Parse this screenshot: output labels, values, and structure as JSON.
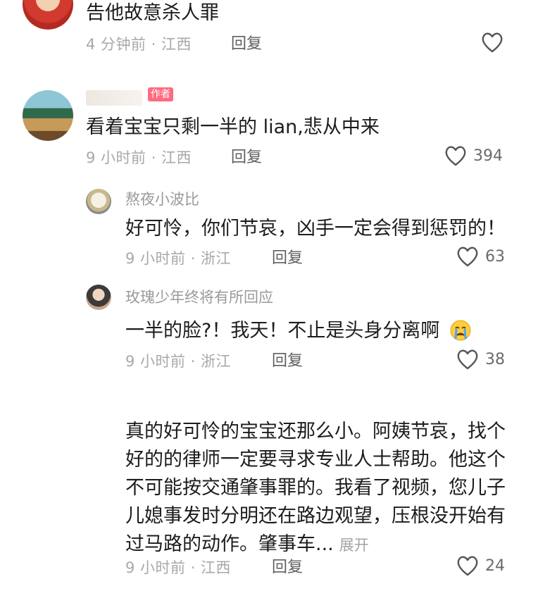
{
  "comments": [
    {
      "text": "告他故意杀人罪",
      "meta": "4 分钟前 · 江西",
      "reply": "回复",
      "likes": ""
    },
    {
      "username": "",
      "badge": "作者",
      "text": "看着宝宝只剩一半的 lian,悲从中来",
      "meta": "9 小时前 · 江西",
      "reply": "回复",
      "likes": "394"
    },
    {
      "username": "熬夜小波比",
      "text": "好可怜，你们节哀，凶手一定会得到惩罚的！",
      "meta": "9 小时前 · 浙江",
      "reply": "回复",
      "likes": "63"
    },
    {
      "username": "玫瑰少年终将有所回应",
      "text": "一半的脸?！我天！不止是头身分离啊",
      "meta": "9 小时前 · 浙江",
      "reply": "回复",
      "likes": "38"
    },
    {
      "lines": [
        "真的好可怜的宝宝还那么小。阿姨节哀，找个",
        "好的的律师一定要寻求专业人士帮助。他这个",
        "不可能按交通肇事罪的。我看了视频，您儿子",
        "儿媳事发时分明还在路边观望，压根没开始有",
        "过马路的动作。肇事车..."
      ],
      "expand": "展开",
      "meta": "9 小时前 · 江西",
      "reply": "回复",
      "likes": "24"
    }
  ],
  "icons": {
    "like": "heart-outline-icon",
    "crying_emoji": "crying-face-icon"
  }
}
